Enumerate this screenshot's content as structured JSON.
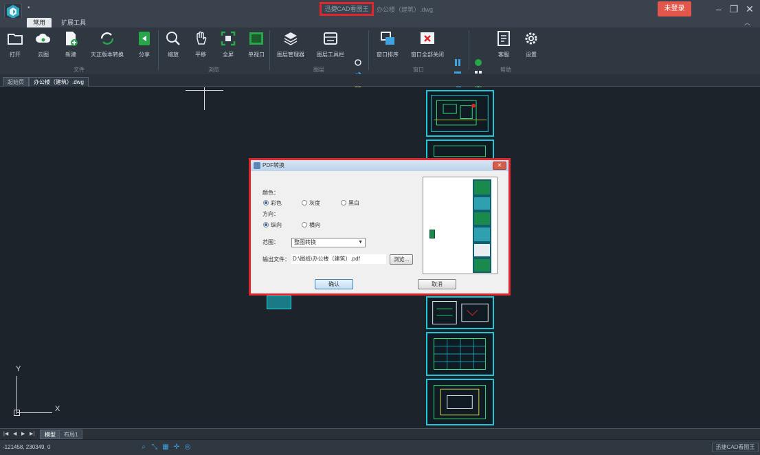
{
  "titlebar": {
    "app_title": "迅捷CAD看图王",
    "doc_title": "办公楼（建筑）.dwg",
    "login_label": "未登录",
    "dot": "•"
  },
  "menu": {
    "tabs": [
      {
        "label": "常用"
      },
      {
        "label": "扩展工具"
      }
    ]
  },
  "ribbon": {
    "buttons": [
      {
        "label": "打开",
        "icon": "folder-open-icon"
      },
      {
        "label": "云图",
        "icon": "cloud-icon"
      },
      {
        "label": "新建",
        "icon": "new-file-icon"
      },
      {
        "label": "天正版本转换",
        "icon": "convert-icon"
      },
      {
        "label": "分享",
        "icon": "share-icon"
      },
      {
        "label": "缩放",
        "icon": "zoom-icon"
      },
      {
        "label": "平移",
        "icon": "hand-pan-icon"
      },
      {
        "label": "全屏",
        "icon": "fullscreen-icon"
      },
      {
        "label": "单视口",
        "icon": "single-viewport-icon"
      },
      {
        "label": "图层管理器",
        "icon": "layers-icon"
      },
      {
        "label": "图层工具栏",
        "icon": "layer-toolbar-icon"
      },
      {
        "label": "窗口排序",
        "icon": "window-sort-icon"
      },
      {
        "label": "窗口全部关闭",
        "icon": "close-all-windows-icon"
      },
      {
        "label": "客服",
        "icon": "support-icon"
      },
      {
        "label": "设置",
        "icon": "settings-icon"
      }
    ],
    "groups": [
      {
        "label": "文件"
      },
      {
        "label": "浏览"
      },
      {
        "label": "图层"
      },
      {
        "label": "窗口"
      },
      {
        "label": "帮助"
      }
    ]
  },
  "doc_tabs": [
    {
      "label": "起始页"
    },
    {
      "label": "办公楼（建筑）.dwg"
    }
  ],
  "dialog": {
    "title": "PDF转换",
    "color_label": "颜色：",
    "color_options": [
      {
        "label": "彩色",
        "selected": true
      },
      {
        "label": "灰度",
        "selected": false
      },
      {
        "label": "黑白",
        "selected": false
      }
    ],
    "orientation_label": "方向：",
    "orientation_options": [
      {
        "label": "纵向",
        "selected": true
      },
      {
        "label": "横向",
        "selected": false
      }
    ],
    "range_label": "范围：",
    "range_value": "整图转换",
    "output_label": "输出文件：",
    "output_path": "D:\\图纸\\办公楼（建筑）.pdf",
    "browse_label": "浏览...",
    "ok_label": "确认",
    "cancel_label": "取消"
  },
  "layout_tabs": [
    {
      "label": "模型"
    },
    {
      "label": "布局1"
    }
  ],
  "statusbar": {
    "coords": "-121458, 230349, 0",
    "brand": "迅捷CAD看图王"
  },
  "ucs": {
    "x_label": "X",
    "y_label": "Y"
  },
  "colors": {
    "accent_red": "#e0262a",
    "cad_cyan": "#1ec8d8",
    "canvas_bg": "#1d232b",
    "login_bg": "#e2574c"
  }
}
